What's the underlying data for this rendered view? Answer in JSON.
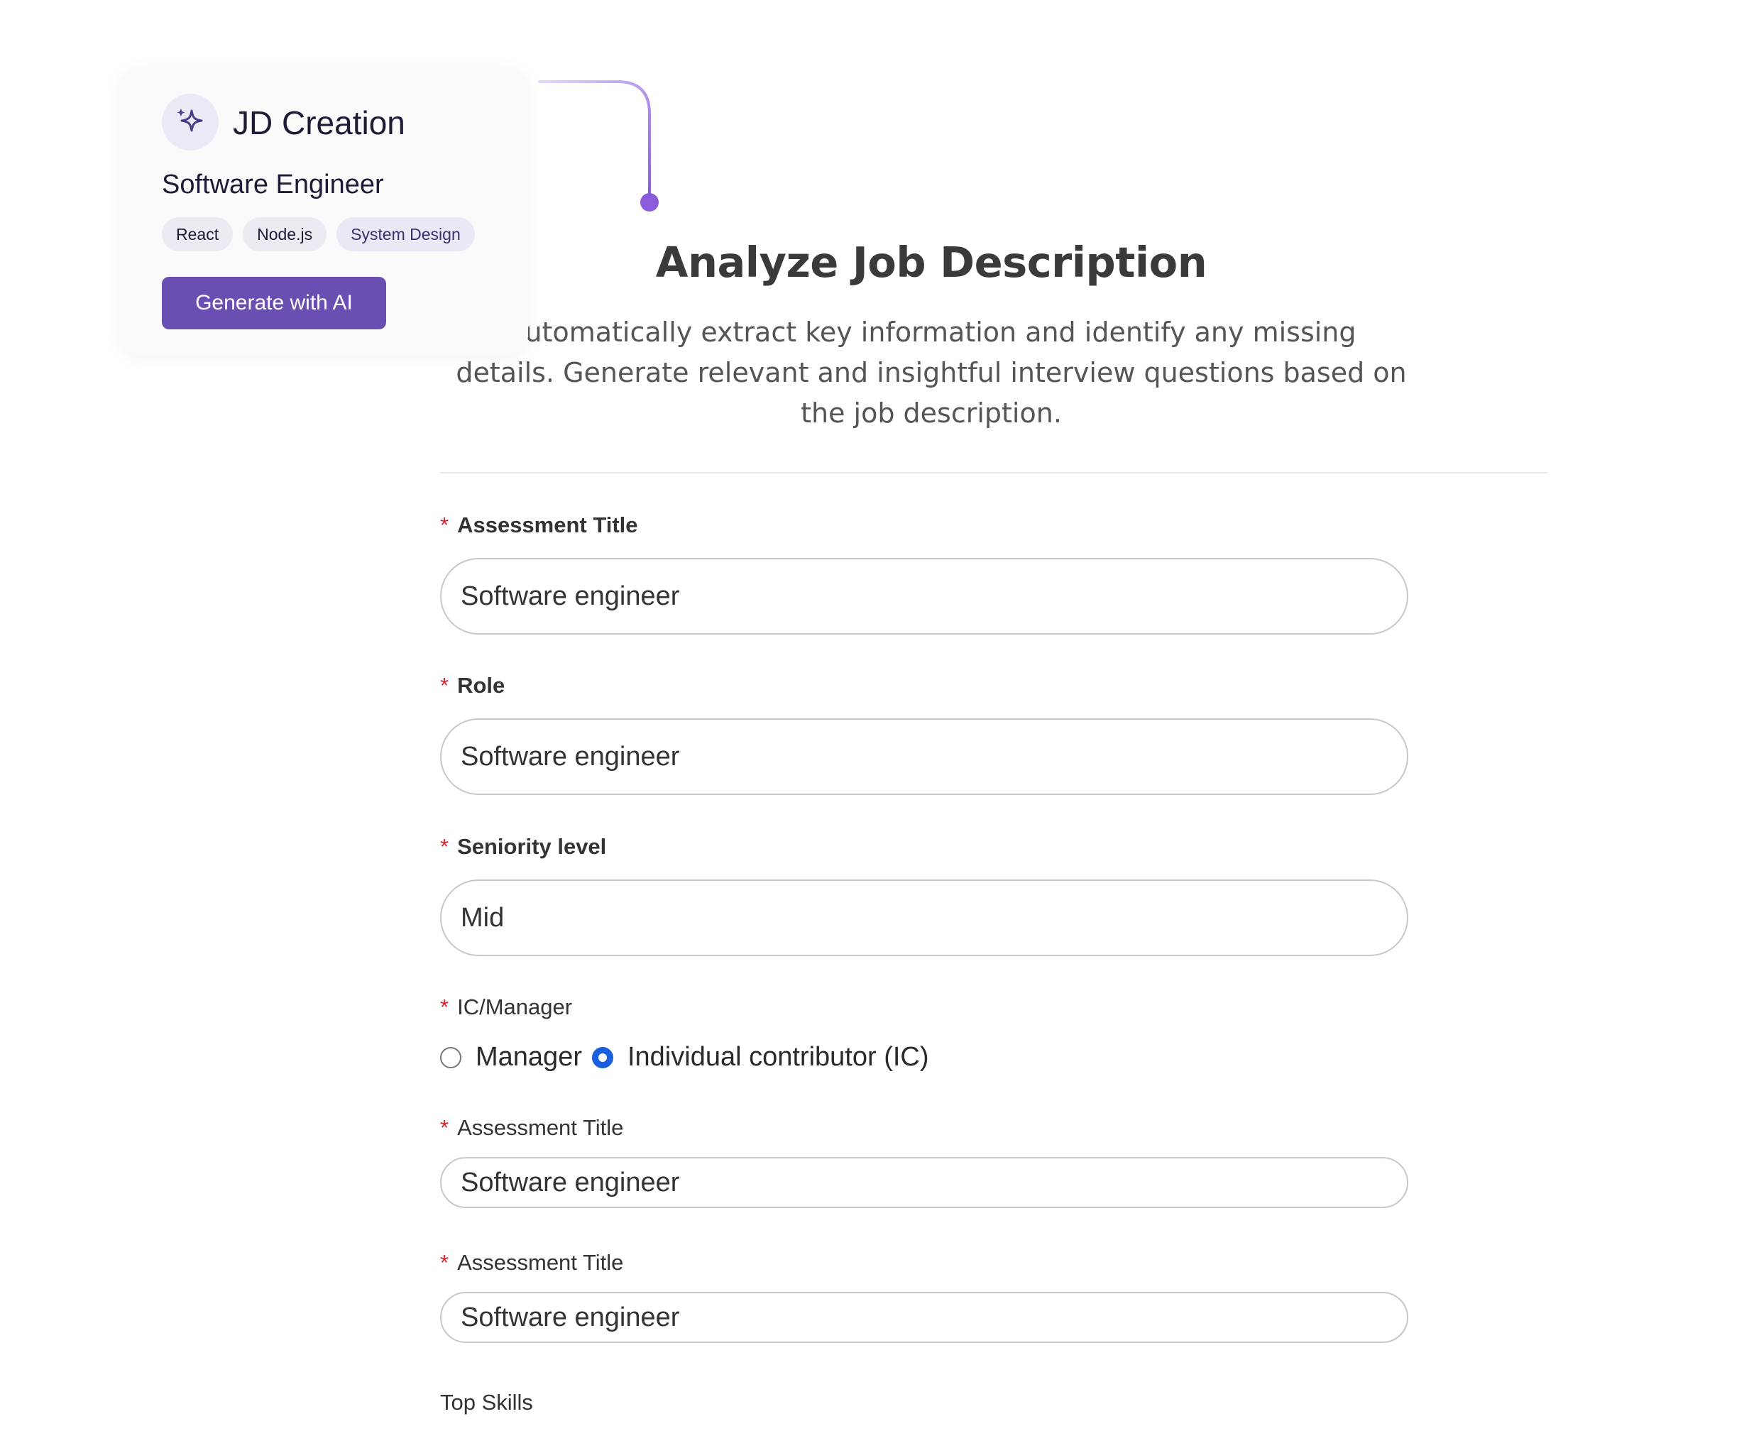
{
  "card": {
    "icon": "sparkle-icon",
    "title": "JD Creation",
    "subtitle": "Software Engineer",
    "tags": [
      "React",
      "Node.js",
      "System Design"
    ],
    "button_label": "Generate with AI",
    "accent_color": "#6a4fb3"
  },
  "header": {
    "title": "Analyze Job Description",
    "description": "Automatically extract key information and identify any missing details. Generate relevant and insightful interview questions based on the job description."
  },
  "form": {
    "required_mark": "*",
    "assessment_title": {
      "label": "Assessment Title",
      "value": "Software engineer"
    },
    "role": {
      "label": "Role",
      "value": "Software engineer"
    },
    "seniority": {
      "label": "Seniority level",
      "value": "Mid"
    },
    "ic_manager": {
      "label": "IC/Manager",
      "options": [
        "Manager",
        "Individual contributor (IC)"
      ],
      "selected": "Individual contributor (IC)"
    },
    "assessment_title_2": {
      "label": "Assessment Title",
      "value": "Software engineer"
    },
    "assessment_title_3": {
      "label": "Assessment Title",
      "value": "Software engineer"
    },
    "top_skills": {
      "label": "Top Skills"
    }
  },
  "colors": {
    "radio_selected": "#1a5fdc",
    "required": "#d9262b"
  }
}
